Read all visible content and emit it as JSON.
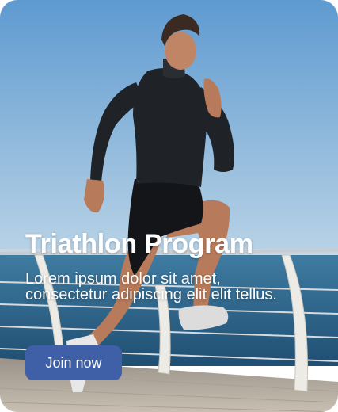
{
  "card": {
    "title": "Triathlon Program",
    "description": "Lorem ipsum dolor sit amet, consectetur adipiscing elit elit tellus.",
    "cta_label": "Join now"
  },
  "colors": {
    "button_bg": "#3f5fa6",
    "text": "#ffffff",
    "sky": "#7aaad3",
    "sea": "#2a5f83"
  }
}
